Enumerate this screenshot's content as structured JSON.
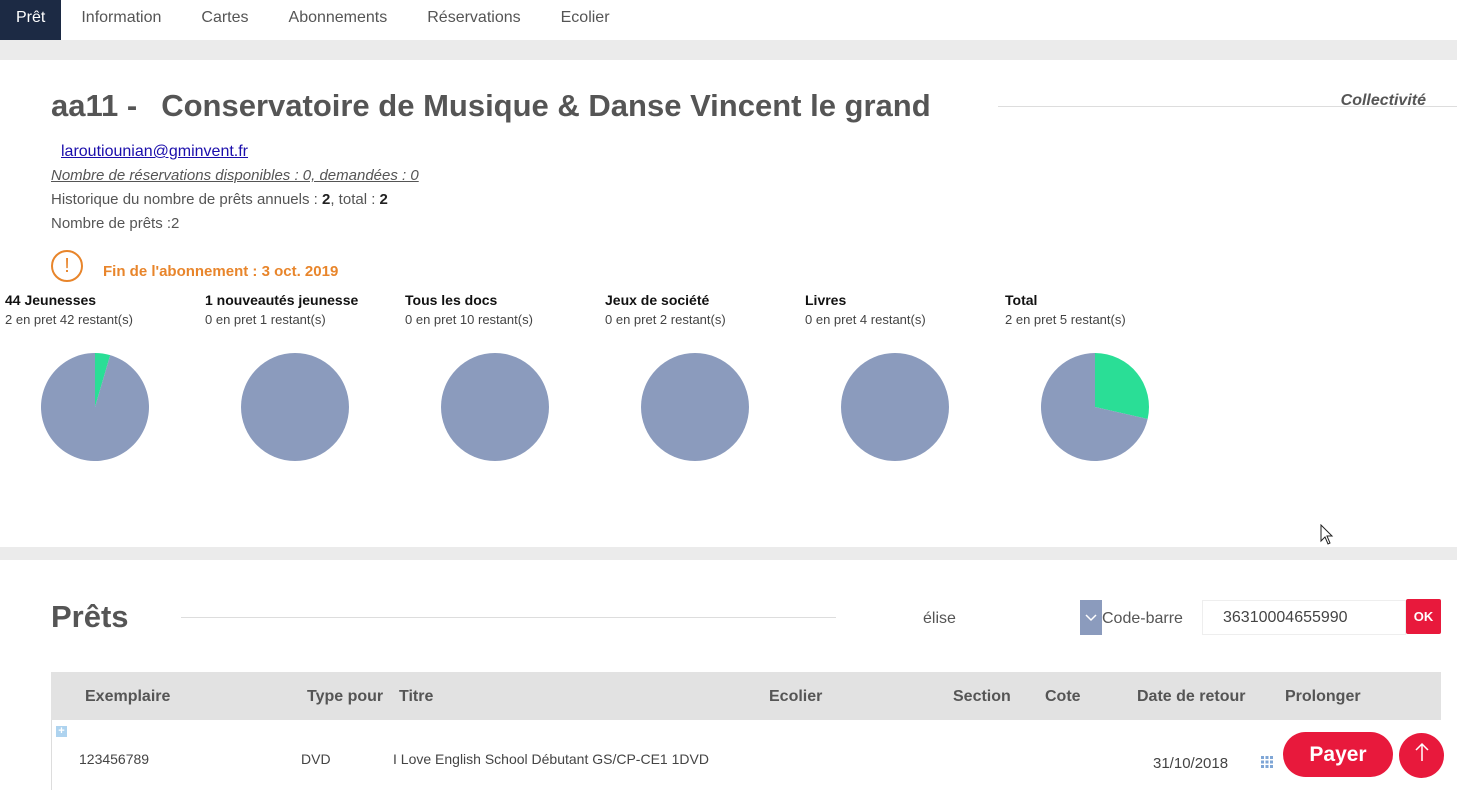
{
  "tabs": [
    {
      "label": "Prêt",
      "active": true
    },
    {
      "label": "Information"
    },
    {
      "label": "Cartes"
    },
    {
      "label": "Abonnements"
    },
    {
      "label": "Réservations"
    },
    {
      "label": "Ecolier"
    }
  ],
  "patron": {
    "code": "aa11 -",
    "name": "Conservatoire de Musique & Danse Vincent le grand",
    "type": "Collectivité",
    "email": "laroutiounian@gminvent.fr",
    "reservations_text": "Nombre de réservations disponibles : 0, demandées : 0",
    "history_prefix": "Historique du nombre de prêts annuels : ",
    "history_annual": "2",
    "history_sep": ", total : ",
    "history_total": "2",
    "loans_count_text": "Nombre de prêts :2",
    "warning_text": "Fin de l'abonnement : 3 oct. 2019"
  },
  "colors": {
    "used": "#2ade96",
    "remaining": "#8b9bbd",
    "accent": "#e8193c",
    "warning": "#e8852b",
    "tab_active": "#1c2a44"
  },
  "chart_data": [
    {
      "type": "pie",
      "title": "44 Jeunesses",
      "subtitle": "2 en pret 42 restant(s)",
      "categories": [
        "en pret",
        "restant(s)"
      ],
      "values": [
        2,
        42
      ]
    },
    {
      "type": "pie",
      "title": "1 nouveautés jeunesse",
      "subtitle": "0 en pret 1 restant(s)",
      "categories": [
        "en pret",
        "restant(s)"
      ],
      "values": [
        0,
        1
      ]
    },
    {
      "type": "pie",
      "title": "Tous les docs",
      "subtitle": "0 en pret 10 restant(s)",
      "categories": [
        "en pret",
        "restant(s)"
      ],
      "values": [
        0,
        10
      ]
    },
    {
      "type": "pie",
      "title": "Jeux de société",
      "subtitle": "0 en pret 2 restant(s)",
      "categories": [
        "en pret",
        "restant(s)"
      ],
      "values": [
        0,
        2
      ]
    },
    {
      "type": "pie",
      "title": "Livres",
      "subtitle": "0 en pret 4 restant(s)",
      "categories": [
        "en pret",
        "restant(s)"
      ],
      "values": [
        0,
        4
      ]
    },
    {
      "type": "pie",
      "title": "Total",
      "subtitle": "2 en pret 5 restant(s)",
      "categories": [
        "en pret",
        "restant(s)"
      ],
      "values": [
        2,
        5
      ]
    }
  ],
  "loans": {
    "title": "Prêts",
    "user": "élise",
    "mode_label": "Code-barre",
    "barcode_value": "36310004655990",
    "ok_label": "OK",
    "columns": [
      "Exemplaire",
      "Type pour",
      "Titre",
      "Ecolier",
      "Section",
      "Cote",
      "Date de retour",
      "Prolonger"
    ],
    "rows": [
      {
        "exemplaire": "123456789",
        "type": "DVD",
        "titre": "I Love English School Débutant GS/CP-CE1 1DVD",
        "ecolier": "",
        "section": "",
        "cote": "",
        "date_retour": "31/10/2018"
      }
    ]
  },
  "actions": {
    "payer_label": "Payer",
    "up_icon": "arrow-up-icon"
  }
}
